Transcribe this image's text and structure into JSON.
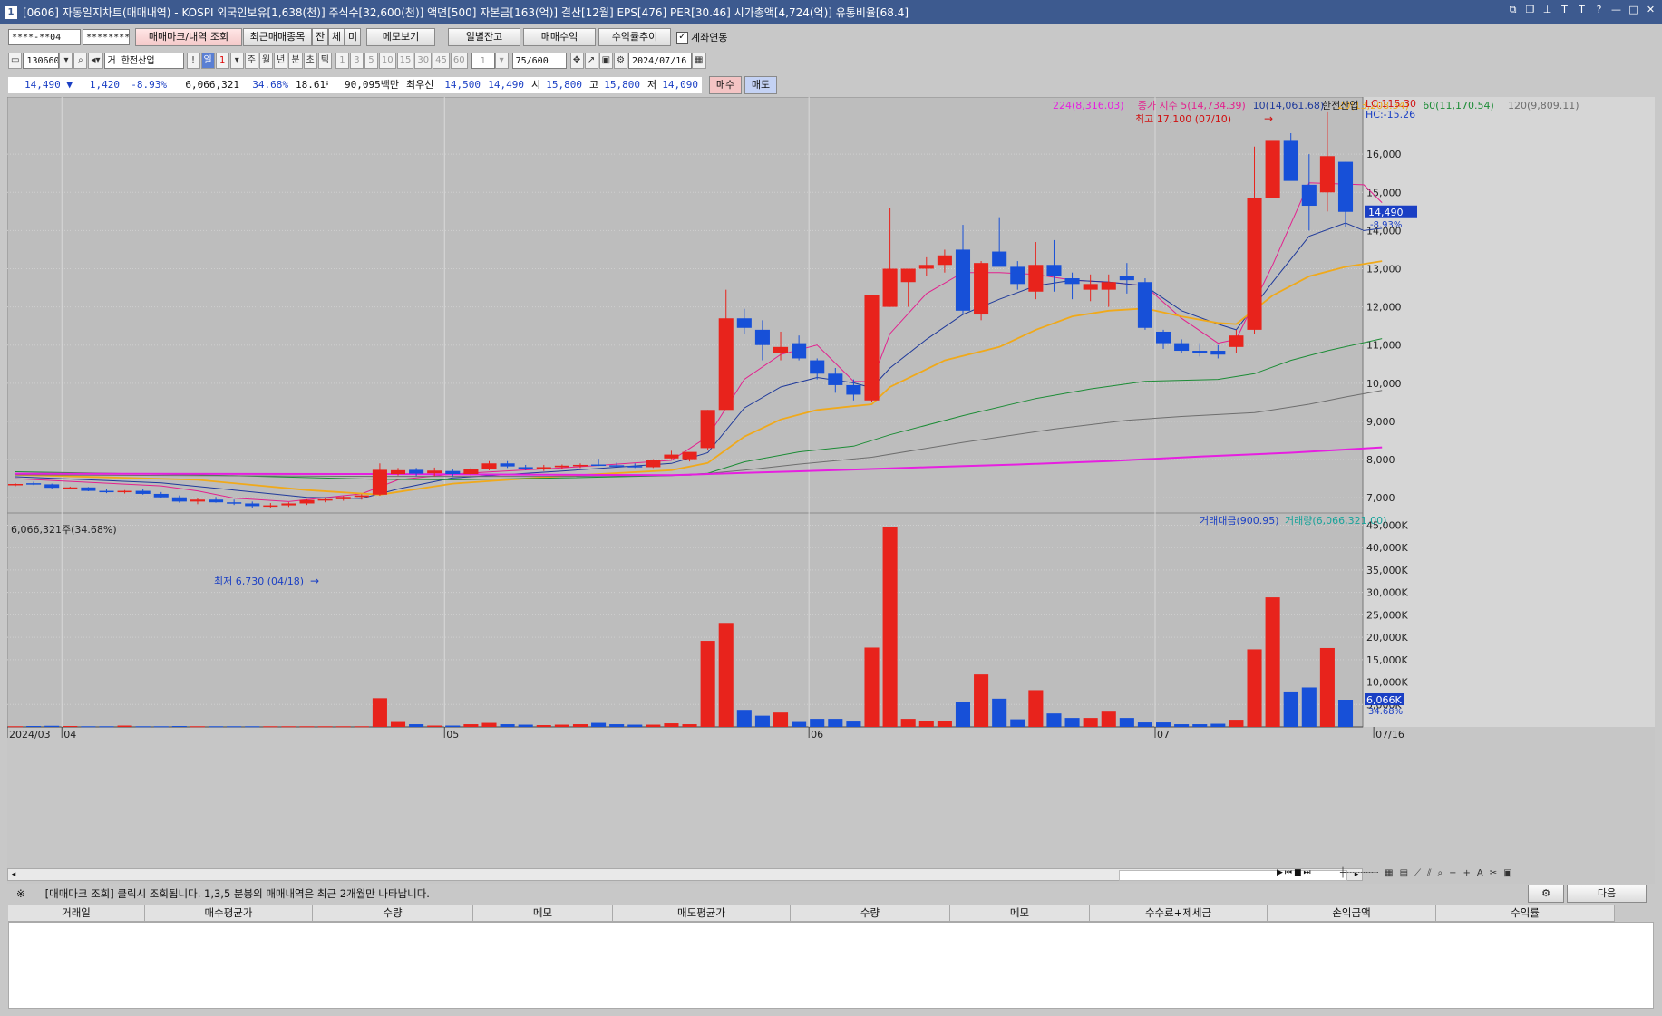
{
  "title": "[0606] 자동일지차트(매매내역) - KOSPI 외국인보유[1,638(천)] 주식수[32,600(천)] 액면[500] 자본금[163(억)] 결산[12월] EPS[476] PER[30.46] 시가총액[4,724(억)] 유통비율[68.4]",
  "title_icon": "1",
  "toolbar": {
    "account": "****-**04",
    "password": "********",
    "trade_mark_button": "매매마크/내역 조회",
    "recent_button": "최근매매종목",
    "mini_buttons": [
      "잔",
      "체",
      "미"
    ],
    "memo_button": "메모보기",
    "daily_balance_button": "일별잔고",
    "trade_profit_button": "매매수익",
    "profit_trend_button": "수익률추이",
    "account_link_label": "계좌연동"
  },
  "toolbar2": {
    "code": "130660",
    "stock_name": "한전산업",
    "name_prefix": "거",
    "excl": "!",
    "period_buttons": [
      "일",
      "1",
      "주",
      "월",
      "년",
      "분",
      "초",
      "틱"
    ],
    "minute_buttons": [
      "1",
      "3",
      "5",
      "10",
      "15",
      "30",
      "45",
      "60"
    ],
    "interval": "1",
    "count": "75",
    "count_max": "/600",
    "date": "2024/07/16"
  },
  "quote": {
    "price": "14,490",
    "dir": "▼",
    "change": "1,420",
    "pct": "-8.93%",
    "volume": "6,066,321",
    "vol_ratio": "34.68%",
    "turnover": "18.61%",
    "amount": "90,095백만",
    "ask_label": "최우선",
    "ask": "14,500",
    "bid": "14,490",
    "open_label": "시",
    "open": "15,800",
    "high_label": "고",
    "high": "15,800",
    "low_label": "저",
    "low": "14,090",
    "buy_button": "매수",
    "sell_button": "매도"
  },
  "chart_data": {
    "type": "candlestick",
    "legend": {
      "ma224": "224(8,316.03)",
      "close_index": "종가 지수 5(14,734.39)",
      "ma10": "10(14,061.68)",
      "ma20": "20(13,208.34)",
      "ma60": "60(11,170.54)",
      "ma120": "120(9,809.11)",
      "stock": "한전산업"
    },
    "lc_label": "LC:115.30",
    "hc_label": "HC:-15.26",
    "high_annotation": "최고 17,100 (07/10)",
    "low_annotation": "최저 6,730 (04/18)",
    "price_label": "14,490",
    "price_pct": "-8.93%",
    "y_ticks": [
      "16,000",
      "15,000",
      "14,000",
      "13,000",
      "12,000",
      "11,000",
      "10,000",
      "9,000",
      "8,000",
      "7,000"
    ],
    "y_tick_values": [
      16000,
      15000,
      14000,
      13000,
      12000,
      11000,
      10000,
      9000,
      8000,
      7000
    ],
    "ylim": [
      6600,
      17500
    ],
    "x_labels": [
      {
        "i": 0,
        "t": "2024/03"
      },
      {
        "i": 3,
        "t": "04"
      },
      {
        "i": 24,
        "t": "05"
      },
      {
        "i": 44,
        "t": "06"
      },
      {
        "i": 63,
        "t": "07"
      },
      {
        "i": 75,
        "t": "07/16"
      }
    ],
    "candles": [
      [
        7350,
        7380,
        7300,
        7360
      ],
      [
        7380,
        7420,
        7330,
        7350
      ],
      [
        7350,
        7370,
        7230,
        7260
      ],
      [
        7260,
        7290,
        7220,
        7270
      ],
      [
        7270,
        7280,
        7170,
        7180
      ],
      [
        7180,
        7220,
        7120,
        7150
      ],
      [
        7150,
        7200,
        7110,
        7180
      ],
      [
        7180,
        7230,
        7080,
        7100
      ],
      [
        7100,
        7150,
        6980,
        7010
      ],
      [
        7010,
        7060,
        6870,
        6900
      ],
      [
        6900,
        6980,
        6830,
        6950
      ],
      [
        6950,
        7020,
        6870,
        6880
      ],
      [
        6880,
        6950,
        6810,
        6850
      ],
      [
        6850,
        6900,
        6740,
        6780
      ],
      [
        6780,
        6860,
        6730,
        6800
      ],
      [
        6800,
        6880,
        6760,
        6850
      ],
      [
        6850,
        6960,
        6810,
        6940
      ],
      [
        6940,
        7000,
        6880,
        6960
      ],
      [
        6960,
        7040,
        6920,
        7020
      ],
      [
        7020,
        7090,
        6950,
        7060
      ],
      [
        7080,
        7900,
        7050,
        7730
      ],
      [
        7620,
        7780,
        7580,
        7720
      ],
      [
        7730,
        7780,
        7570,
        7630
      ],
      [
        7640,
        7790,
        7560,
        7710
      ],
      [
        7700,
        7760,
        7560,
        7620
      ],
      [
        7620,
        7800,
        7570,
        7760
      ],
      [
        7760,
        7960,
        7720,
        7900
      ],
      [
        7900,
        7960,
        7780,
        7820
      ],
      [
        7800,
        7860,
        7720,
        7740
      ],
      [
        7740,
        7860,
        7700,
        7800
      ],
      [
        7800,
        7870,
        7750,
        7840
      ],
      [
        7840,
        7900,
        7780,
        7860
      ],
      [
        7870,
        8020,
        7830,
        7850
      ],
      [
        7850,
        7920,
        7800,
        7830
      ],
      [
        7830,
        7900,
        7780,
        7820
      ],
      [
        7800,
        8010,
        7780,
        8000
      ],
      [
        8030,
        8230,
        8010,
        8130
      ],
      [
        8010,
        8190,
        7950,
        8200
      ],
      [
        8300,
        9300,
        8250,
        9300
      ],
      [
        9300,
        12450,
        10100,
        11700
      ],
      [
        11700,
        11950,
        11300,
        11450
      ],
      [
        11400,
        11650,
        10600,
        11000
      ],
      [
        10800,
        11350,
        10600,
        10950
      ],
      [
        11050,
        11250,
        10600,
        10650
      ],
      [
        10600,
        10650,
        10100,
        10250
      ],
      [
        10250,
        10400,
        9750,
        9950
      ],
      [
        9950,
        10100,
        9550,
        9700
      ],
      [
        9550,
        12300,
        9500,
        12300
      ],
      [
        12000,
        14600,
        12000,
        13000
      ],
      [
        12650,
        13000,
        12000,
        13000
      ],
      [
        13000,
        13300,
        12800,
        13100
      ],
      [
        13100,
        13500,
        12900,
        13350
      ],
      [
        13500,
        14150,
        11800,
        11900
      ],
      [
        11800,
        13200,
        11650,
        13150
      ],
      [
        13450,
        14350,
        13300,
        13050
      ],
      [
        13050,
        13200,
        12450,
        12600
      ],
      [
        12400,
        13700,
        12200,
        13100
      ],
      [
        13100,
        13750,
        12400,
        12800
      ],
      [
        12750,
        12900,
        12200,
        12600
      ],
      [
        12450,
        12850,
        12150,
        12600
      ],
      [
        12450,
        12850,
        12000,
        12650
      ],
      [
        12800,
        13150,
        12350,
        12700
      ],
      [
        12650,
        12750,
        11400,
        11450
      ],
      [
        11350,
        11400,
        10900,
        11050
      ],
      [
        11050,
        11150,
        10800,
        10850
      ],
      [
        10850,
        11050,
        10700,
        10800
      ],
      [
        10850,
        11000,
        10650,
        10750
      ],
      [
        10950,
        11400,
        10800,
        11250
      ],
      [
        11400,
        16200,
        11300,
        14850
      ],
      [
        14850,
        15350,
        15050,
        16350
      ],
      [
        16350,
        16550,
        15350,
        15300
      ],
      [
        15200,
        16000,
        14000,
        14650
      ],
      [
        15000,
        17100,
        14500,
        15950
      ],
      [
        15800,
        15800,
        14090,
        14490
      ]
    ],
    "ma_series": {
      "ma5": [
        [
          0,
          7500
        ],
        [
          8,
          7310
        ],
        [
          10,
          7180
        ],
        [
          12,
          6990
        ],
        [
          15,
          6900
        ],
        [
          19,
          7100
        ],
        [
          21,
          7470
        ],
        [
          24,
          7620
        ],
        [
          30,
          7780
        ],
        [
          36,
          7980
        ],
        [
          38,
          8600
        ],
        [
          40,
          10100
        ],
        [
          42,
          10750
        ],
        [
          44,
          11000
        ],
        [
          46,
          10050
        ],
        [
          47,
          10040
        ],
        [
          48,
          11300
        ],
        [
          50,
          12350
        ],
        [
          52,
          12900
        ],
        [
          54,
          12900
        ],
        [
          56,
          12850
        ],
        [
          58,
          12700
        ],
        [
          60,
          12650
        ],
        [
          62,
          12550
        ],
        [
          64,
          11700
        ],
        [
          66,
          11050
        ],
        [
          67,
          11150
        ],
        [
          69,
          13100
        ],
        [
          71,
          15250
        ],
        [
          74,
          15200
        ],
        [
          75,
          14730
        ]
      ],
      "ma10": [
        [
          0,
          7550
        ],
        [
          8,
          7390
        ],
        [
          12,
          7200
        ],
        [
          16,
          7010
        ],
        [
          19,
          6980
        ],
        [
          21,
          7230
        ],
        [
          24,
          7520
        ],
        [
          30,
          7700
        ],
        [
          36,
          7900
        ],
        [
          38,
          8180
        ],
        [
          40,
          9350
        ],
        [
          42,
          9900
        ],
        [
          44,
          10150
        ],
        [
          46,
          10010
        ],
        [
          47,
          9880
        ],
        [
          48,
          10400
        ],
        [
          50,
          11150
        ],
        [
          52,
          11800
        ],
        [
          54,
          12200
        ],
        [
          56,
          12550
        ],
        [
          58,
          12700
        ],
        [
          60,
          12650
        ],
        [
          62,
          12550
        ],
        [
          64,
          11900
        ],
        [
          66,
          11550
        ],
        [
          67,
          11400
        ],
        [
          69,
          12650
        ],
        [
          71,
          13850
        ],
        [
          73,
          14200
        ],
        [
          74,
          14000
        ],
        [
          75,
          14060
        ]
      ],
      "ma20": [
        [
          0,
          7600
        ],
        [
          10,
          7470
        ],
        [
          16,
          7200
        ],
        [
          20,
          7080
        ],
        [
          24,
          7370
        ],
        [
          30,
          7570
        ],
        [
          36,
          7720
        ],
        [
          38,
          7910
        ],
        [
          40,
          8600
        ],
        [
          42,
          9050
        ],
        [
          44,
          9300
        ],
        [
          47,
          9450
        ],
        [
          48,
          9900
        ],
        [
          51,
          10600
        ],
        [
          54,
          10950
        ],
        [
          56,
          11400
        ],
        [
          58,
          11750
        ],
        [
          60,
          11900
        ],
        [
          62,
          11960
        ],
        [
          64,
          11750
        ],
        [
          66,
          11580
        ],
        [
          67,
          11550
        ],
        [
          69,
          12300
        ],
        [
          71,
          12800
        ],
        [
          73,
          13050
        ],
        [
          75,
          13200
        ]
      ],
      "ma60": [
        [
          0,
          7680
        ],
        [
          10,
          7600
        ],
        [
          20,
          7480
        ],
        [
          24,
          7470
        ],
        [
          30,
          7520
        ],
        [
          36,
          7580
        ],
        [
          38,
          7640
        ],
        [
          40,
          7940
        ],
        [
          43,
          8200
        ],
        [
          46,
          8350
        ],
        [
          48,
          8650
        ],
        [
          52,
          9150
        ],
        [
          56,
          9600
        ],
        [
          59,
          9850
        ],
        [
          62,
          10050
        ],
        [
          66,
          10100
        ],
        [
          68,
          10250
        ],
        [
          70,
          10600
        ],
        [
          72,
          10850
        ],
        [
          75,
          11170
        ]
      ],
      "ma120": [
        [
          0,
          7600
        ],
        [
          20,
          7560
        ],
        [
          30,
          7560
        ],
        [
          37,
          7590
        ],
        [
          40,
          7720
        ],
        [
          43,
          7880
        ],
        [
          47,
          8060
        ],
        [
          52,
          8450
        ],
        [
          57,
          8800
        ],
        [
          61,
          9030
        ],
        [
          64,
          9130
        ],
        [
          68,
          9230
        ],
        [
          71,
          9450
        ],
        [
          73,
          9640
        ],
        [
          75,
          9810
        ]
      ],
      "ma224": [
        [
          0,
          7630
        ],
        [
          20,
          7620
        ],
        [
          36,
          7590
        ],
        [
          40,
          7650
        ],
        [
          45,
          7720
        ],
        [
          50,
          7800
        ],
        [
          55,
          7870
        ],
        [
          60,
          7960
        ],
        [
          65,
          8080
        ],
        [
          70,
          8180
        ],
        [
          75,
          8320
        ]
      ]
    },
    "volume": {
      "header": "6,066,321주(34.68%)",
      "legend_amount": "거래대금(900.95)",
      "legend_volume": "거래량(6,066,321.00)",
      "current_label": "6,066K",
      "current_pct": "34.68%",
      "y_ticks": [
        "45,000K",
        "40,000K",
        "35,000K",
        "30,000K",
        "25,000K",
        "20,000K",
        "15,000K",
        "10,000K",
        "5,000K"
      ],
      "y_tick_values": [
        45000,
        40000,
        35000,
        30000,
        25000,
        20000,
        15000,
        10000,
        5000
      ],
      "ylim": [
        0,
        45500
      ],
      "values": [
        150,
        200,
        250,
        200,
        150,
        150,
        300,
        150,
        150,
        200,
        150,
        150,
        150,
        150,
        150,
        150,
        150,
        150,
        150,
        150,
        6400,
        1100,
        600,
        300,
        300,
        600,
        900,
        600,
        500,
        400,
        500,
        600,
        900,
        600,
        500,
        500,
        800,
        600,
        19200,
        23200,
        3800,
        2500,
        3200,
        1100,
        1800,
        1800,
        1200,
        17700,
        44500,
        1800,
        1400,
        1400,
        5600,
        11700,
        6300,
        1700,
        8200,
        3000,
        2000,
        2000,
        3400,
        2000,
        1000,
        1000,
        600,
        600,
        700,
        1600,
        17300,
        28900,
        7900,
        8800,
        17600,
        6066
      ]
    },
    "colors": {
      "up": "#e8231c",
      "down": "#1750d8",
      "ma5": "#e3208e",
      "ma10": "#1f3a9b",
      "ma20": "#f0a91a",
      "ma60": "#1c8c36",
      "ma120": "#6e6e6e",
      "ma224": "#e61fe0"
    }
  },
  "note": {
    "mark": "※",
    "text": "[매매마크 조회] 클릭시 조회됩니다. 1,3,5 분봉의 매매내역은 최근 2개월만 나타납니다.",
    "next_button": "다음"
  },
  "table": {
    "headers": [
      "거래일",
      "매수평균가",
      "수량",
      "메모",
      "매도평균가",
      "수량",
      "메모",
      "수수료+제세금",
      "손익금액",
      "수익률"
    ]
  }
}
